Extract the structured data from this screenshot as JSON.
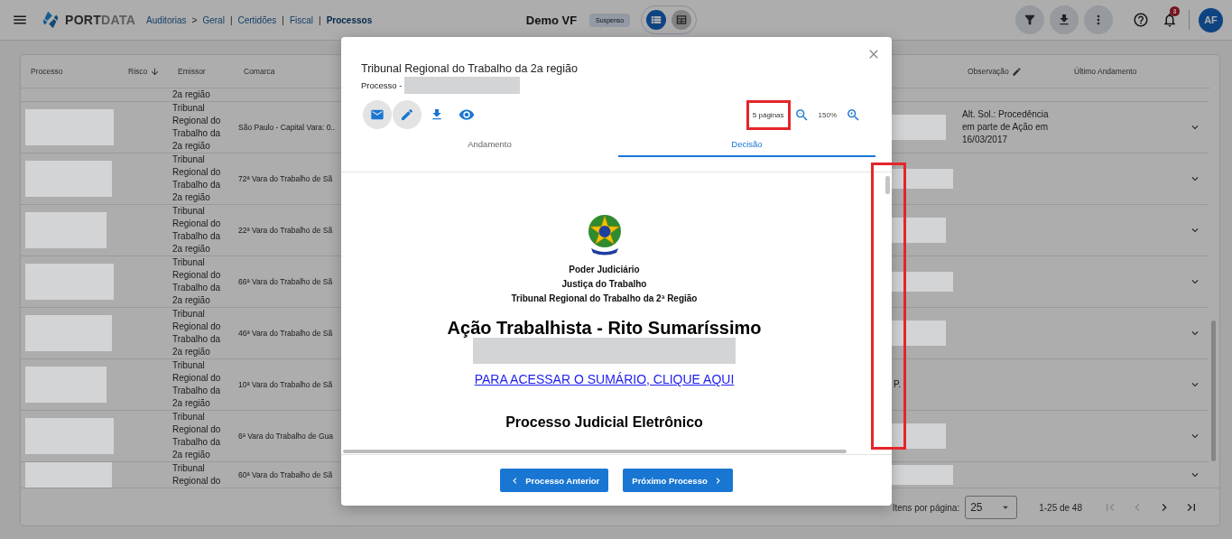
{
  "header": {
    "logo": {
      "dark": "PORT",
      "light": "DATA"
    },
    "breadcrumbs": [
      {
        "label": "Auditorias",
        "separator": ">",
        "selected": false
      },
      {
        "label": "Geral",
        "separator": "|",
        "selected": false
      },
      {
        "label": "Certidões",
        "separator": "|",
        "selected": false
      },
      {
        "label": "Fiscal",
        "separator": "|",
        "selected": false
      },
      {
        "label": "Processos",
        "selected": true
      }
    ],
    "title": "Demo VF",
    "status_badge": "Suspenso",
    "view_toggle": [
      {
        "kind": "list",
        "selected": true
      },
      {
        "kind": "table",
        "selected": false
      }
    ],
    "toolbar_buttons": [
      {
        "kind": "filter"
      },
      {
        "kind": "download"
      },
      {
        "kind": "more"
      }
    ],
    "notifications": {
      "count": "3"
    },
    "avatar": "AF"
  },
  "table": {
    "columns": [
      {
        "label": "Processo",
        "sorted": false,
        "editable": false
      },
      {
        "label": "Risco",
        "sorted": true,
        "editable": false
      },
      {
        "label": "Emissor",
        "sorted": false,
        "editable": false
      },
      {
        "label": "Comarca",
        "sorted": false,
        "editable": false
      },
      {
        "label": "Observação",
        "sorted": false,
        "editable": true
      },
      {
        "label": "Último Andamento",
        "sorted": false,
        "editable": false
      }
    ],
    "rows": [
      {
        "kind": "partial",
        "emissor": "2a região"
      },
      {
        "kind": "full",
        "emissor": "Tribunal Regional do Trabalho da 2a região",
        "comarca": "São Paulo - Capital Vara: 0..",
        "observacao": "Alt. Sol.: Procedência em parte de Ação em 16/03/2017",
        "expanded": false
      },
      {
        "kind": "full",
        "emissor": "Tribunal Regional do Trabalho da 2a região",
        "comarca": "72ª Vara do Trabalho de Sã",
        "expanded": false
      },
      {
        "kind": "full",
        "emissor": "Tribunal Regional do Trabalho da 2a região",
        "comarca": "22ª Vara do Trabalho de Sã",
        "expanded": false
      },
      {
        "kind": "full",
        "emissor": "Tribunal Regional do Trabalho da 2a região",
        "comarca": "66ª Vara do Trabalho de Sã",
        "expanded": false
      },
      {
        "kind": "full",
        "emissor": "Tribunal Regional do Trabalho da 2a região",
        "comarca": "46ª Vara do Trabalho de Sã",
        "expanded": false
      },
      {
        "kind": "full",
        "emissor": "Tribunal Regional do Trabalho da 2a região",
        "comarca": "10ª Vara do Trabalho de Sã",
        "column_5": "P.",
        "expanded": false
      },
      {
        "kind": "full",
        "emissor": "Tribunal Regional do Trabalho da 2a região",
        "comarca": "6ª Vara do Trabalho de Gua",
        "expanded": false
      },
      {
        "kind": "full",
        "emissor": "Tribunal Regional do",
        "comarca": "60ª Vara do Trabalho de Sã",
        "expanded": false
      }
    ],
    "paginator": {
      "label": "Itens por página:",
      "page_size": "25",
      "range": "1-25 de 48",
      "buttons": [
        {
          "kind": "first",
          "disabled": true
        },
        {
          "kind": "previous",
          "disabled": true
        },
        {
          "kind": "next",
          "disabled": false
        },
        {
          "kind": "last",
          "disabled": false
        }
      ]
    }
  },
  "modal": {
    "title": "Tribunal Regional do Trabalho da 2a região",
    "process_label": "Processo -",
    "actions": [
      {
        "kind": "mail",
        "highlighted": true
      },
      {
        "kind": "edit",
        "highlighted": true
      },
      {
        "kind": "download",
        "highlighted": false
      },
      {
        "kind": "view",
        "highlighted": false
      }
    ],
    "page_count": "5 páginas",
    "page_count_highlighted": true,
    "scroll_track_highlighted": true,
    "zoom": "150%",
    "tabs": [
      {
        "label": "Andamento",
        "selected": false
      },
      {
        "label": "Decisão",
        "selected": true
      }
    ],
    "document": {
      "lines": [
        "Poder Judiciário",
        "Justiça do Trabalho",
        "Tribunal Regional do Trabalho da 2ª Região"
      ],
      "heading": "Ação Trabalhista - Rito Sumaríssimo",
      "link": "PARA ACESSAR O SUMÁRIO, CLIQUE AQUI",
      "subheading": "Processo Judicial Eletrônico"
    },
    "buttons": [
      {
        "kind": "previous",
        "label": "Processo Anterior"
      },
      {
        "kind": "next",
        "label": "Próximo Processo"
      }
    ]
  }
}
